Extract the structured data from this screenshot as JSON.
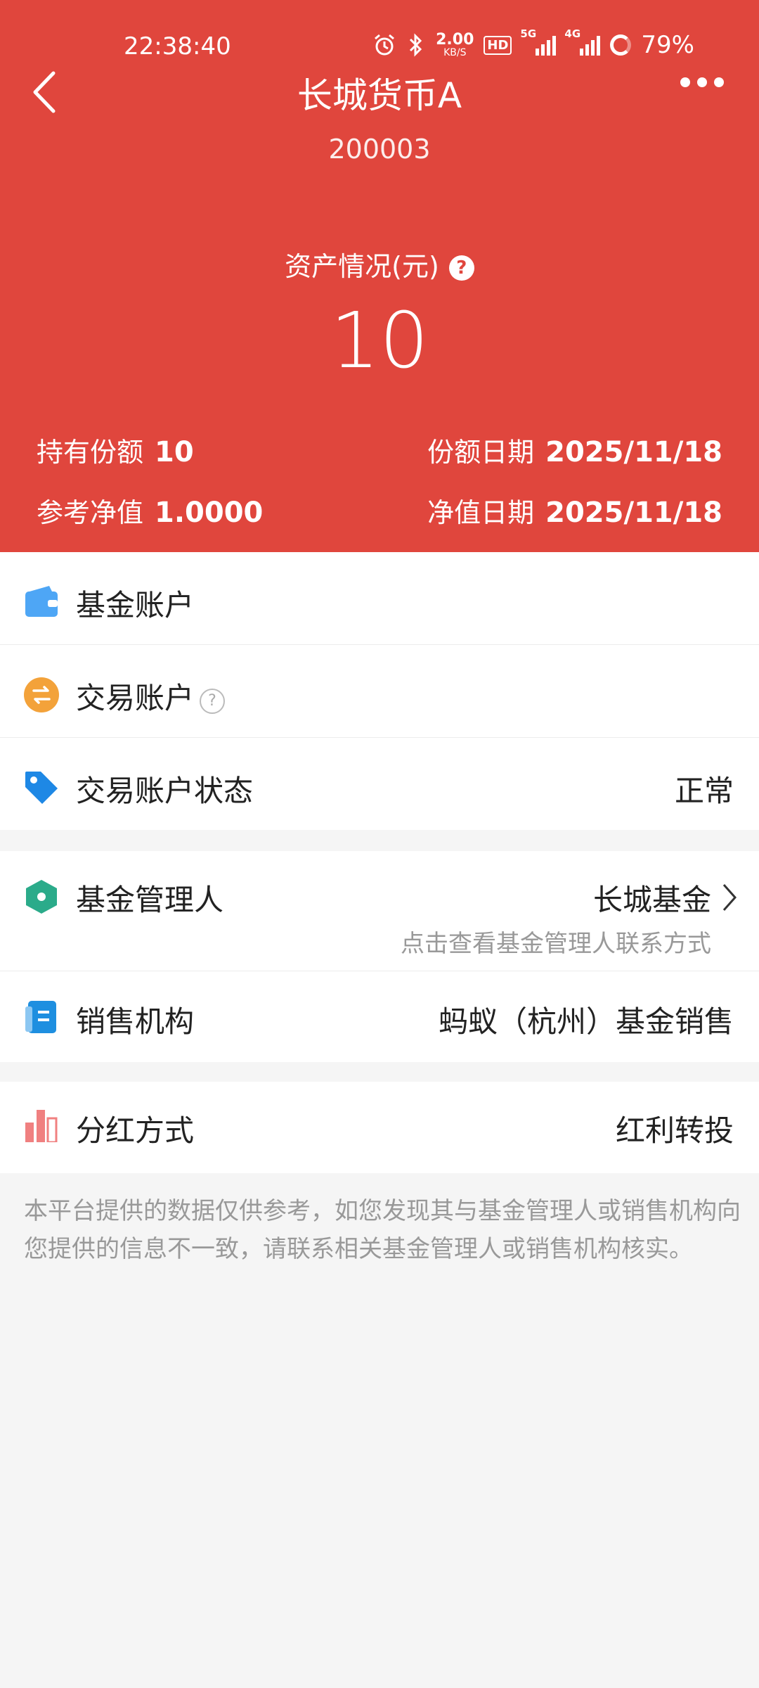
{
  "status_bar": {
    "time": "22:38:40",
    "net_speed": "2.00",
    "net_unit": "KB/S",
    "hd_label": "HD",
    "sig1_label": "5G",
    "sig2_label": "4G",
    "battery": "79%"
  },
  "header": {
    "title": "长城货币A",
    "code": "200003",
    "asset_label": "资产情况(元)",
    "asset_value": "10",
    "shares_label": "持有份额",
    "shares_value": "10",
    "shares_date_label": "份额日期",
    "shares_date_value": "2025/11/18",
    "nav_label": "参考净值",
    "nav_value": "1.0000",
    "nav_date_label": "净值日期",
    "nav_date_value": "2025/11/18"
  },
  "accounts": {
    "fund_account_label": "基金账户",
    "trade_account_label": "交易账户",
    "trade_status_label": "交易账户状态",
    "trade_status_value": "正常"
  },
  "manager": {
    "label": "基金管理人",
    "value": "长城基金",
    "hint": "点击查看基金管理人联系方式",
    "sales_label": "销售机构",
    "sales_value": "蚂蚁（杭州）基金销售"
  },
  "dividend": {
    "label": "分红方式",
    "value": "红利转投"
  },
  "disclaimer": "本平台提供的数据仅供参考，如您发现其与基金管理人或销售机构向您提供的信息不一致，请联系相关基金管理人或销售机构核实。",
  "colors": {
    "header_red": "#e0463d",
    "wallet_blue": "#4ea6f5",
    "exchange_orange": "#f3a23a",
    "tag_blue": "#1e88e5",
    "hex_green": "#2bab8a",
    "book_blue": "#1e8fe0",
    "bar_red": "#f08080"
  },
  "icons": [
    "back-icon",
    "more-icon",
    "alarm-icon",
    "bluetooth-icon",
    "battery-icon",
    "help-icon",
    "wallet-icon",
    "exchange-icon",
    "tag-icon",
    "hexagon-icon",
    "chevron-right-icon",
    "book-icon",
    "bar-chart-icon"
  ]
}
